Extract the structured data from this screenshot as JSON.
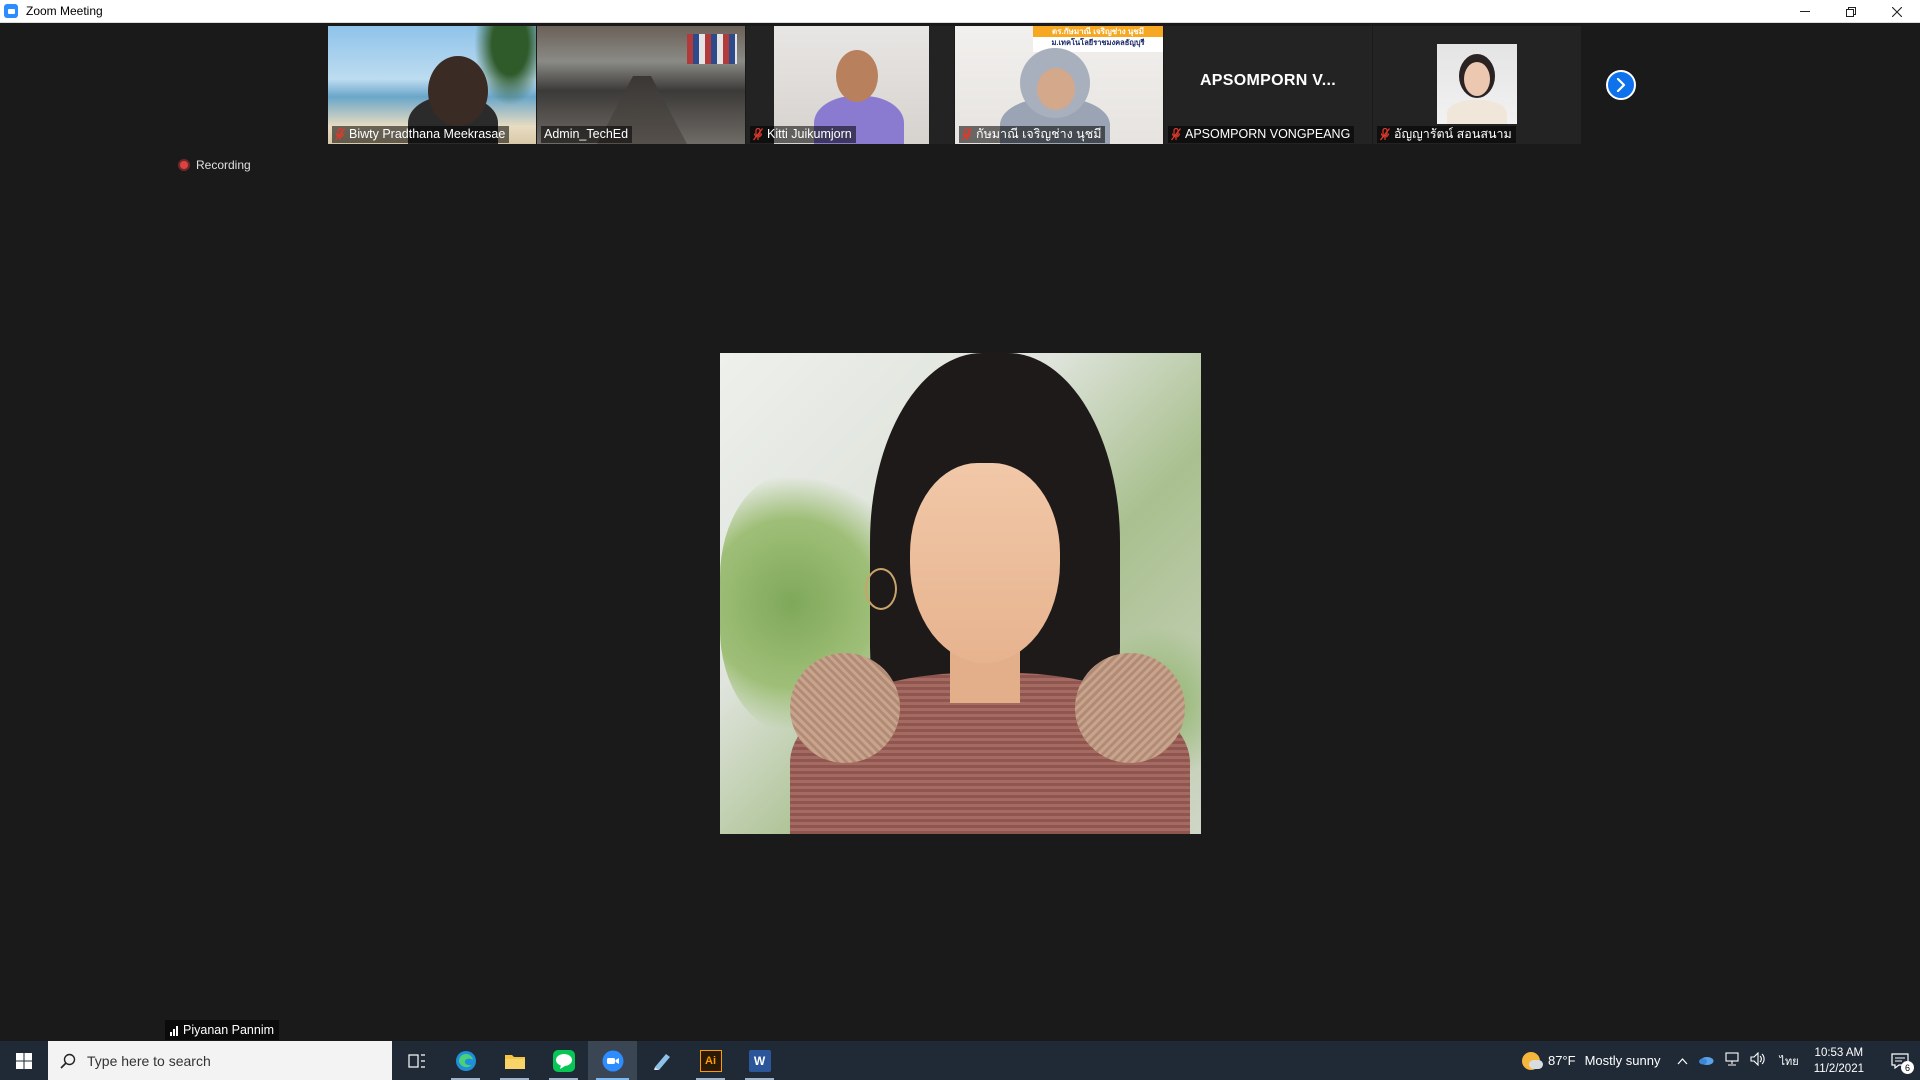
{
  "window": {
    "title": "Zoom Meeting",
    "minimize": "—",
    "restore": "❐",
    "close": "✕"
  },
  "participants": [
    {
      "name": "Biwty Pradthana Meekrasae",
      "muted": true,
      "scene": "beach"
    },
    {
      "name": "Admin_TechEd",
      "muted": false,
      "scene": "room"
    },
    {
      "name": "Kitti Juikumjorn",
      "muted": true,
      "scene": "office"
    },
    {
      "name": "กัษมาณี เจริญช่าง นุชมี",
      "muted": true,
      "scene": "white"
    },
    {
      "name": "APSOMPORN VONGPEANG",
      "center_name": "APSOMPORN  V...",
      "muted": true,
      "scene": "dark"
    },
    {
      "name": "อัญญารัตน์ สอนสนาม",
      "muted": true,
      "scene": "portrait"
    }
  ],
  "banner_text": {
    "line1": "ดร.กัษมาณี เจริญช่าง นุชมี",
    "line2": "ม.เทคโนโลยีราชมงคลธัญบุรี"
  },
  "recording": {
    "label": "Recording"
  },
  "active_speaker": {
    "name": "Piyanan Pannim"
  },
  "next_page_icon": "chevron-right-icon",
  "taskbar": {
    "search_placeholder": "Type here to search",
    "apps": [
      "task-view",
      "edge",
      "file-explorer",
      "line",
      "zoom",
      "notepad",
      "illustrator",
      "word"
    ],
    "illustrator_label": "Ai",
    "word_label": "W",
    "weather_temp": "87°F",
    "weather_desc": "Mostly sunny",
    "lang": "ไทย",
    "time": "10:53 AM",
    "date": "11/2/2021",
    "notification_count": "6"
  },
  "colors": {
    "accent": "#0e72ed",
    "taskbar": "#1f2a36",
    "stage": "#1a1a1a",
    "banner": "#f7a823"
  }
}
